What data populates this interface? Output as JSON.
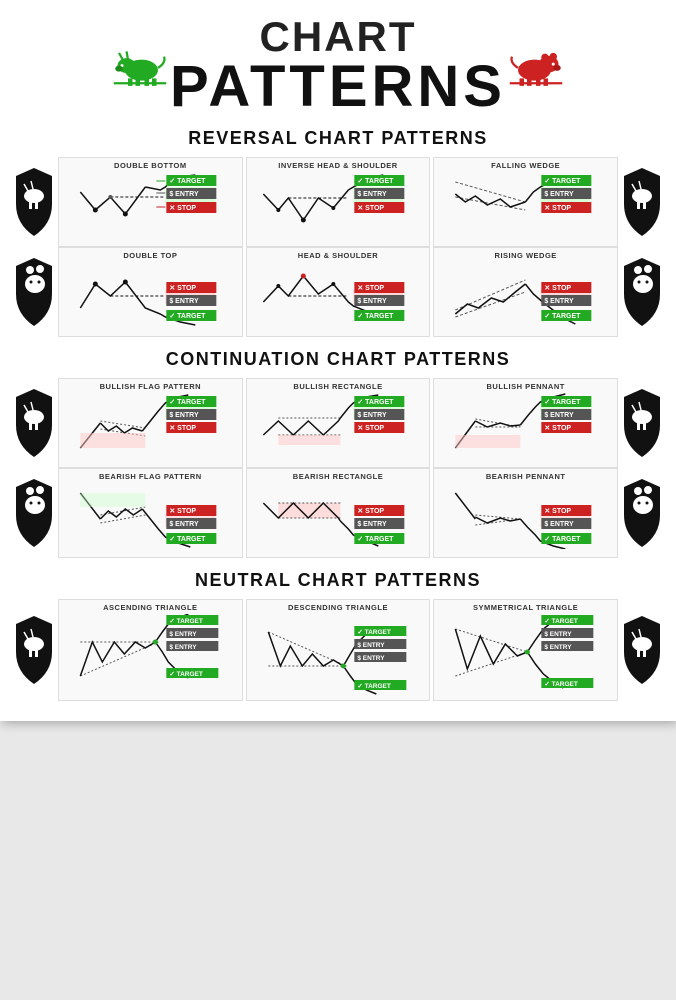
{
  "header": {
    "chart": "CHART",
    "patterns": "PATTERNS"
  },
  "sections": {
    "reversal": {
      "title": "REVERSAL CHART PATTERNS",
      "rows": [
        {
          "patterns": [
            {
              "name": "DOUBLE BOTTOM",
              "type": "double-bottom"
            },
            {
              "name": "INVERSE HEAD & SHOULDER",
              "type": "inverse-head-shoulder"
            },
            {
              "name": "FALLING WEDGE",
              "type": "falling-wedge"
            }
          ]
        },
        {
          "patterns": [
            {
              "name": "DOUBLE TOP",
              "type": "double-top"
            },
            {
              "name": "HEAD & SHOULDER",
              "type": "head-shoulder"
            },
            {
              "name": "RISING WEDGE",
              "type": "rising-wedge"
            }
          ]
        }
      ]
    },
    "continuation": {
      "title": "CONTINUATION CHART PATTERNS",
      "rows": [
        {
          "patterns": [
            {
              "name": "BULLISH FLAG PATTERN",
              "type": "bullish-flag"
            },
            {
              "name": "BULLISH RECTANGLE",
              "type": "bullish-rectangle"
            },
            {
              "name": "BULLISH PENNANT",
              "type": "bullish-pennant"
            }
          ]
        },
        {
          "patterns": [
            {
              "name": "BEARISH FLAG PATTERN",
              "type": "bearish-flag"
            },
            {
              "name": "BEARISH RECTANGLE",
              "type": "bearish-rectangle"
            },
            {
              "name": "BEARISH PENNANT",
              "type": "bearish-pennant"
            }
          ]
        }
      ]
    },
    "neutral": {
      "title": "NEUTRAL CHART PATTERNS",
      "rows": [
        {
          "patterns": [
            {
              "name": "ASCENDING TRIANGLE",
              "type": "ascending-triangle"
            },
            {
              "name": "DESCENDING TRIANGLE",
              "type": "descending-triangle"
            },
            {
              "name": "SYMMETRICAL TRIANGLE",
              "type": "symmetrical-triangle"
            }
          ]
        }
      ]
    }
  }
}
